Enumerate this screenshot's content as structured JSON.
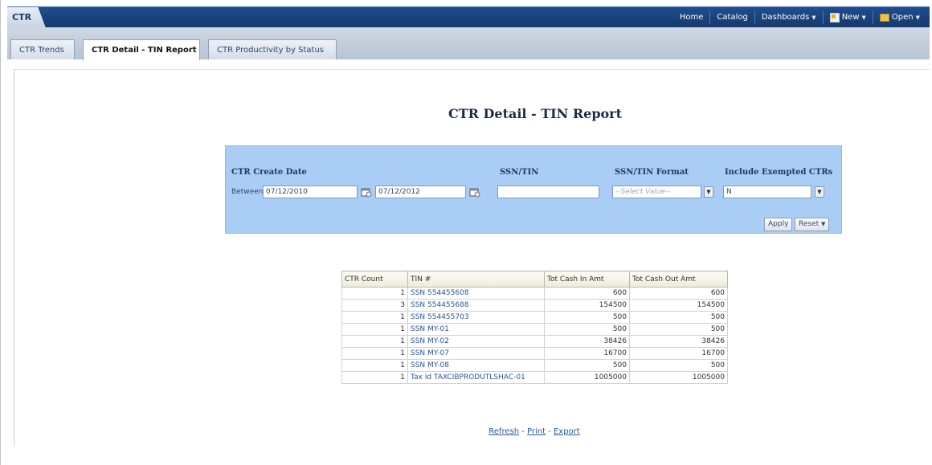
{
  "app": {
    "title": "CTR"
  },
  "topnav": {
    "home": "Home",
    "catalog": "Catalog",
    "dashboards": "Dashboards",
    "new": "New",
    "open": "Open"
  },
  "tabs": [
    {
      "label": "CTR Trends"
    },
    {
      "label": "CTR Detail - TIN Report",
      "active": true
    },
    {
      "label": "CTR Productivity by Status"
    }
  ],
  "page_title": "CTR Detail - TIN Report",
  "prompts": {
    "create_date_label": "CTR Create Date",
    "between_label": "Between",
    "date_from": "07/12/2010",
    "date_to": "07/12/2012",
    "ssn_tin_label": "SSN/TIN",
    "ssn_tin_value": "",
    "format_label": "SSN/TIN Format",
    "format_placeholder": "--Select Value--",
    "exempted_label": "Include Exempted CTRs",
    "exempted_value": "N",
    "apply_label": "Apply",
    "reset_label": "Reset"
  },
  "table": {
    "headers": [
      "CTR Count",
      "TIN #",
      "Tot Cash In Amt",
      "Tot Cash Out Amt"
    ],
    "rows": [
      [
        "1",
        "SSN 554455608",
        "600",
        "600"
      ],
      [
        "3",
        "SSN 554455688",
        "154500",
        "154500"
      ],
      [
        "1",
        "SSN 554455703",
        "500",
        "500"
      ],
      [
        "1",
        "SSN MY-01",
        "500",
        "500"
      ],
      [
        "1",
        "SSN MY-02",
        "38426",
        "38426"
      ],
      [
        "1",
        "SSN MY-07",
        "16700",
        "16700"
      ],
      [
        "1",
        "SSN MY-08",
        "500",
        "500"
      ],
      [
        "1",
        "Tax Id TAXCIBPRODUTLSHAC-01",
        "1005000",
        "1005000"
      ]
    ]
  },
  "footer": {
    "refresh": "Refresh",
    "print": "Print",
    "export": "Export",
    "separator": " - "
  },
  "colors": {
    "topbar": "#1f4e8f",
    "prompt_panel": "#a9cdf5",
    "link": "#2a56a0"
  }
}
